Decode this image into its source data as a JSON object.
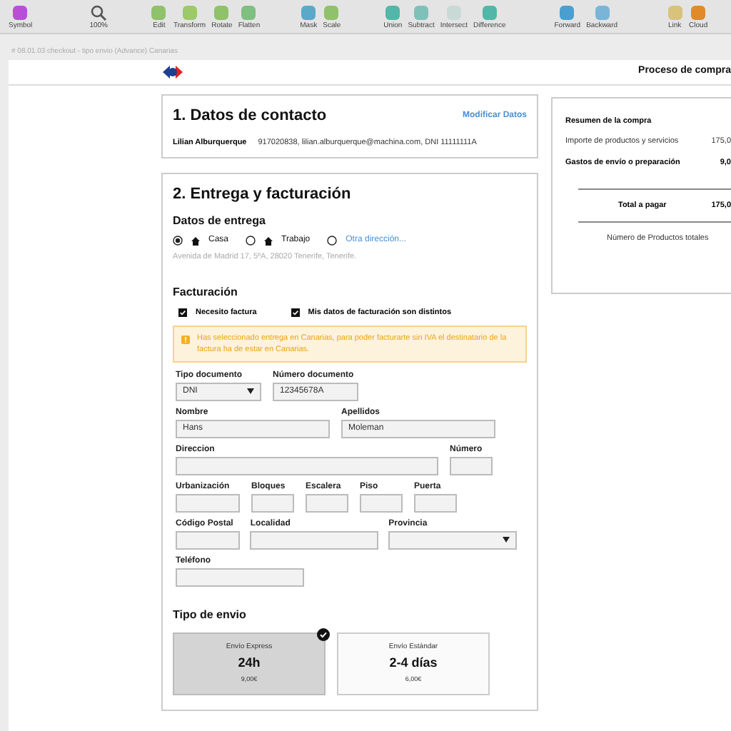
{
  "toolbar": {
    "items": [
      {
        "label": "Symbol"
      },
      {
        "label": "100%"
      },
      {
        "label": "Edit"
      },
      {
        "label": "Transform"
      },
      {
        "label": "Rotate"
      },
      {
        "label": "Flatten"
      },
      {
        "label": "Mask"
      },
      {
        "label": "Scale"
      },
      {
        "label": "Union"
      },
      {
        "label": "Subtract"
      },
      {
        "label": "Intersect"
      },
      {
        "label": "Difference"
      },
      {
        "label": "Forward"
      },
      {
        "label": "Backward"
      },
      {
        "label": "Link"
      },
      {
        "label": "Cloud"
      }
    ]
  },
  "artboard": {
    "title": "# 08.01.03 checkout - tipo envio (Advance) Canarias"
  },
  "header": {
    "title": "Proceso de compra"
  },
  "contact": {
    "title": "1. Datos de contacto",
    "link": "Modificar Datos",
    "name": "Lilian Alburquerque",
    "details": "917020838, lilian.alburquerque@machina.com, DNI 11111111A"
  },
  "delivery": {
    "title": "2. Entrega y facturación",
    "subtitle": "Datos de entrega",
    "options": [
      {
        "kind": "home",
        "label": "Casa",
        "selected": true
      },
      {
        "kind": "home",
        "label": "Trabajo",
        "selected": false
      },
      {
        "kind": "link",
        "label": "Otra dirección...",
        "selected": false
      }
    ],
    "address": "Avenida de Madrid 17, 5ºA, 28020 Tenerife, Tenerife."
  },
  "billing": {
    "title": "Facturación",
    "checks": [
      {
        "label": "Necesito factura",
        "checked": true
      },
      {
        "label": "Mis datos de facturación son distintos",
        "checked": true
      }
    ],
    "warning": "Has seleccionado entrega en Canarias, para poder facturarte sin IVA el destinatario de la factura ha de estar en Canarias.",
    "rows": [
      [
        {
          "label": "Tipo documento",
          "kind": "select",
          "value": "DNI"
        },
        {
          "label": "Número documento",
          "kind": "input",
          "value": "12345678A"
        }
      ],
      [
        {
          "label": "Nombre",
          "kind": "input",
          "value": "Hans"
        },
        {
          "label": "Apellidos",
          "kind": "input",
          "value": "Moleman"
        }
      ],
      [
        {
          "label": "Direccion",
          "kind": "input"
        },
        {
          "label": "Número",
          "kind": "input"
        }
      ],
      [
        {
          "label": "Urbanización",
          "kind": "input"
        },
        {
          "label": "Bloques",
          "kind": "input"
        },
        {
          "label": "Escalera",
          "kind": "input"
        },
        {
          "label": "Piso",
          "kind": "input"
        },
        {
          "label": "Puerta",
          "kind": "input"
        }
      ],
      [
        {
          "label": "Código Postal",
          "kind": "input"
        },
        {
          "label": "Localidad",
          "kind": "input"
        },
        {
          "label": "Provincia",
          "kind": "select"
        }
      ],
      [
        {
          "label": "Teléfono",
          "kind": "input"
        }
      ]
    ]
  },
  "shipping": {
    "title": "Tipo de envio",
    "options": [
      {
        "name": "Envío Express",
        "time": "24h",
        "price": "9,00€",
        "selected": true
      },
      {
        "name": "Envío Estándar",
        "time": "2-4 días",
        "price": "6,00€",
        "selected": false
      }
    ]
  },
  "summary": {
    "title": "Resumen de la compra",
    "lines": [
      {
        "label": "Importe de productos y servicios",
        "value": "175,0",
        "bold": false
      },
      {
        "label": "Gastos de envío o preparación",
        "value": "9,0",
        "bold": true
      }
    ],
    "total_label": "Total a pagar",
    "total_value": "175,0",
    "count_label": "Número de Productos totales"
  }
}
